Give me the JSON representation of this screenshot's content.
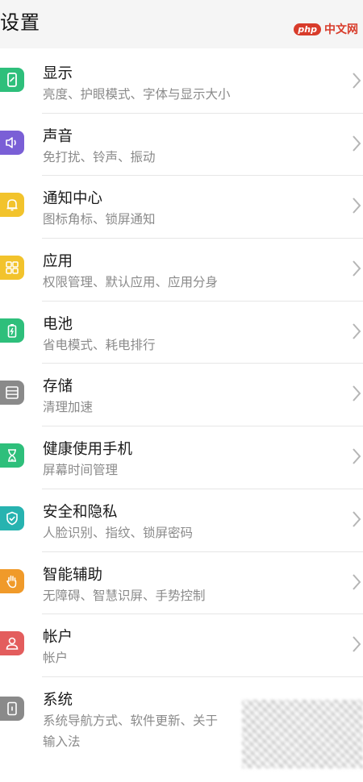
{
  "header": {
    "title": "设置"
  },
  "watermark": {
    "badge": "php",
    "text": "中文网"
  },
  "items": [
    {
      "title": "显示",
      "subtitle": "亮度、护眼模式、字体与显示大小",
      "icon": "display-icon",
      "color": "#2ebf7b"
    },
    {
      "title": "声音",
      "subtitle": "免打扰、铃声、振动",
      "icon": "speaker-icon",
      "color": "#7a5fd6"
    },
    {
      "title": "通知中心",
      "subtitle": "图标角标、锁屏通知",
      "icon": "bell-icon",
      "color": "#f2c32c"
    },
    {
      "title": "应用",
      "subtitle": "权限管理、默认应用、应用分身",
      "icon": "apps-grid-icon",
      "color": "#f2c32c"
    },
    {
      "title": "电池",
      "subtitle": "省电模式、耗电排行",
      "icon": "battery-icon",
      "color": "#2ebf7b"
    },
    {
      "title": "存储",
      "subtitle": "清理加速",
      "icon": "storage-icon",
      "color": "#8a8a8a"
    },
    {
      "title": "健康使用手机",
      "subtitle": "屏幕时间管理",
      "icon": "hourglass-icon",
      "color": "#2ebf7b"
    },
    {
      "title": "安全和隐私",
      "subtitle": "人脸识别、指纹、锁屏密码",
      "icon": "shield-icon",
      "color": "#27b3b0"
    },
    {
      "title": "智能辅助",
      "subtitle": "无障碍、智慧识屏、手势控制",
      "icon": "hand-icon",
      "color": "#f09a2a"
    },
    {
      "title": "帐户",
      "subtitle": "帐户",
      "icon": "account-icon",
      "color": "#e35d5d"
    },
    {
      "title": "系统",
      "subtitle": "系统导航方式、软件更新、关于",
      "subtitle2": "输入法",
      "icon": "phone-icon",
      "color": "#8a8a8a"
    }
  ]
}
